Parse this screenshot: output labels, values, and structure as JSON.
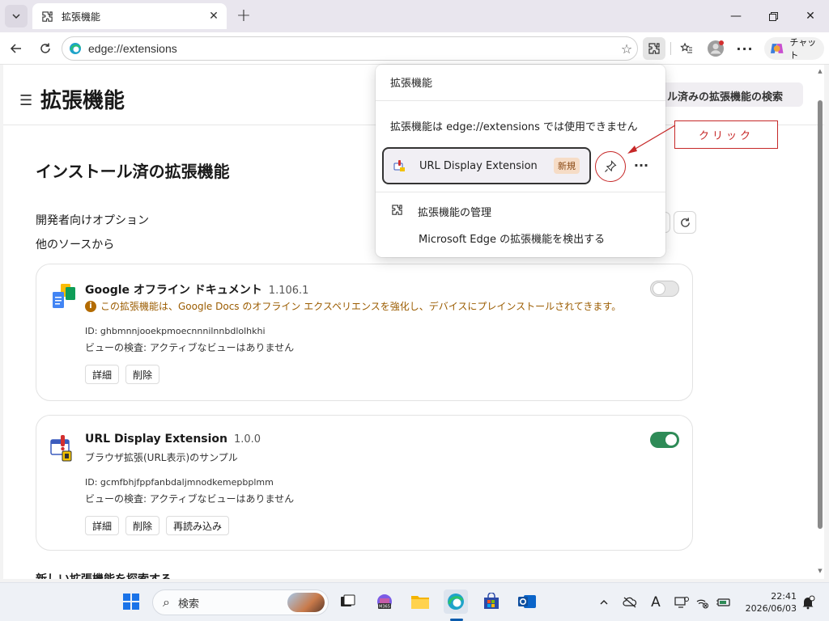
{
  "tab": {
    "title": "拡張機能"
  },
  "address": {
    "url": "edge://extensions"
  },
  "toolbar": {
    "copilot_label": "チャット"
  },
  "page": {
    "title": "拡張機能",
    "search_placeholder": "ル済みの拡張機能の検索",
    "section_title": "インストール済の拡張機能",
    "dev_options": "開発者向けオプション",
    "other_sources": "他のソースから",
    "bottom_text": "新しい拡張機能を探索する"
  },
  "extensions": [
    {
      "name": "Google オフライン ドキュメント",
      "version": "1.106.1",
      "description": "この拡張機能は、Google Docs のオフライン エクスペリエンスを強化し、デバイスにプレインストールされてきます。",
      "id": "ID: ghbmnnjooekpmoecnnnilnnbdlolhkhi",
      "inspect": "ビューの検査: アクティブなビューはありません",
      "buttons": [
        "詳細",
        "削除"
      ],
      "enabled": false
    },
    {
      "name": "URL Display Extension",
      "version": "1.0.0",
      "description": "ブラウザ拡張(URL表示)のサンプル",
      "id": "ID: gcmfbhjfppfanbdaljmnodkemepbplmm",
      "inspect": "ビューの検査: アクティブなビューはありません",
      "buttons": [
        "詳細",
        "削除",
        "再読み込み"
      ],
      "enabled": true
    }
  ],
  "popup": {
    "title": "拡張機能",
    "message": "拡張機能は edge://extensions では使用できません",
    "extension_name": "URL Display Extension",
    "new_badge": "新規",
    "manage": "拡張機能の管理",
    "discover": "Microsoft Edge の拡張機能を検出する"
  },
  "annotation": {
    "label": "クリック"
  },
  "taskbar": {
    "search_label": "検索",
    "time": "22:41",
    "date": "2026/06/03"
  },
  "colors": {
    "accent": "#0b5cad",
    "toggle_on": "#2e8b57",
    "annotation_red": "#c62828",
    "warning": "#9b5c00"
  }
}
